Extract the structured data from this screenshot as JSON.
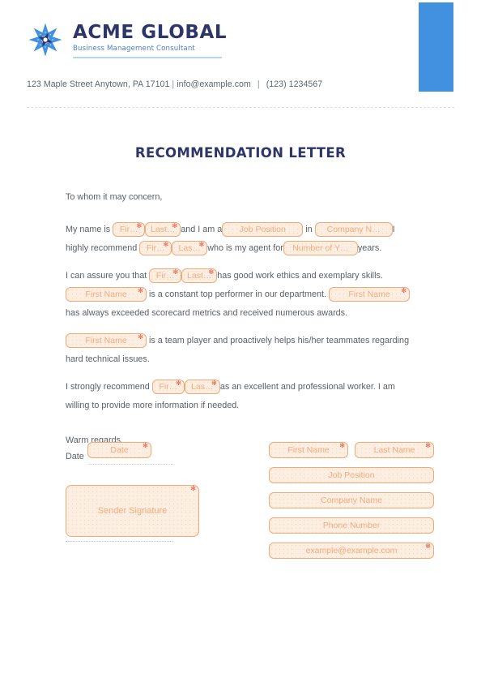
{
  "colors": {
    "accent_blue": "#4191e0",
    "brand_navy": "#2e3569",
    "tagline_blue": "#4b7fc4",
    "field_border": "#f2a977",
    "field_fill": "#fdeee2",
    "field_text": "#f3ab7d",
    "required_star": "#e8543f",
    "body_text": "#595f66"
  },
  "header": {
    "brand_name": "ACME GLOBAL",
    "tagline": "Business Management Consultant",
    "logo_icon": "snowflake-star-icon",
    "contact": {
      "address": "123 Maple Street Anytown, PA 17101",
      "separator_1": "|",
      "email": "info@example.com",
      "separator_2": "|",
      "phone": "(123) 1234567"
    }
  },
  "title": "RECOMMENDATION LETTER",
  "body": {
    "salutation": "To whom it may concern,",
    "p1": {
      "t1": "My name is",
      "f_first": "Fir…",
      "f_last": "Last…",
      "t2": "and I am a",
      "f_job": "Job Position",
      "t3": "in",
      "f_company": "Company N…",
      "t4": "I highly recommend",
      "f_first2": "Fir…",
      "f_last2": "Las…",
      "t5": "who is my agent for",
      "f_years": "Number of Y…",
      "t6": "years."
    },
    "p2": {
      "t1": "I can assure you that",
      "f_first": "Fir…",
      "f_last": "Last…",
      "t2": "has good work ethics and exemplary skills.",
      "f_firstname1": "First Name",
      "t3": "is a constant top performer in our department.",
      "f_firstname2": "First Name",
      "t4": "has always exceeded scorecard metrics and received numerous awards."
    },
    "p3": {
      "f_firstname": "First Name",
      "t1": "is a team player and proactively helps his/her teammates regarding hard technical issues."
    },
    "p4": {
      "t1": "I strongly recommend",
      "f_first": "Fir…",
      "f_last": "Las…",
      "t2": "as an excellent and professional worker. I am willing to provide more information if needed."
    },
    "closing": "Warm regards,"
  },
  "signature_section": {
    "date_label": "Date",
    "date_field": "Date",
    "signature_field": "Sender Signature"
  },
  "sender_fields": {
    "first_name": "First Name",
    "last_name": "Last Name",
    "job_position": "Job Position",
    "company_name": "Company Name",
    "phone_number": "Phone Number",
    "email": "example@example.com"
  },
  "required_marker": "✻"
}
